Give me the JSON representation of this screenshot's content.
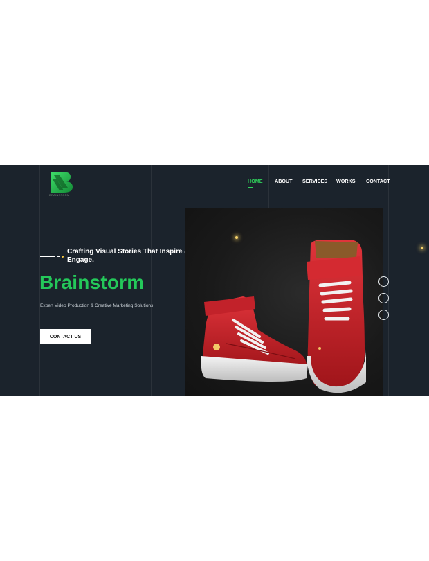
{
  "logo": {
    "text": "BRAINSTORM",
    "icon": "brainstorm-b-logo",
    "color": "#1fbf4a"
  },
  "nav": {
    "items": [
      {
        "label": "HOME",
        "active": true
      },
      {
        "label": "ABOUT",
        "active": false
      },
      {
        "label": "SERVICES",
        "active": false
      },
      {
        "label": "WORKS",
        "active": false
      },
      {
        "label": "CONTACT",
        "active": false
      }
    ]
  },
  "hero": {
    "tagline": "Crafting Visual Stories That Inspire & Engage.",
    "title": "Brainstorm",
    "subtitle": "Expert Video Production & Creative Marketing Solutions",
    "cta_label": "CONTACT US",
    "image": "red-high-top-sneakers-photo"
  },
  "slider": {
    "count": 3
  },
  "colors": {
    "background": "#1b232c",
    "accent": "#24c85a",
    "nav_active": "#2fd35b",
    "orb": "#f7d36b"
  }
}
